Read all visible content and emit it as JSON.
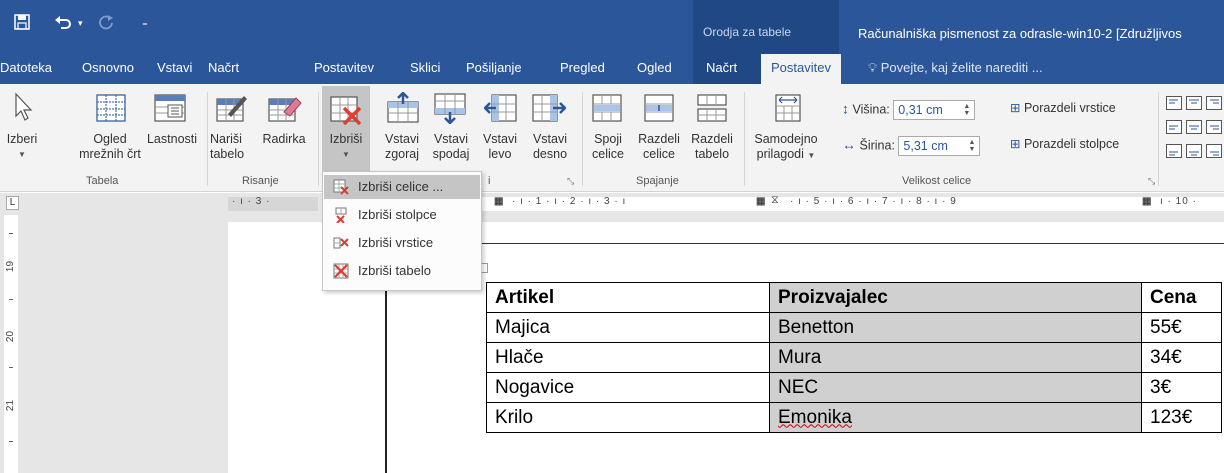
{
  "titlebar": {
    "contextual_group": "Orodja za tabele",
    "doc_title": "Računalniška pismenost za odrasle-win10-2 [Združljivos"
  },
  "tabs": [
    {
      "label": "Datoteka"
    },
    {
      "label": "Osnovno"
    },
    {
      "label": "Vstavi"
    },
    {
      "label": "Načrt"
    },
    {
      "label": "Postavitev"
    },
    {
      "label": "Sklici"
    },
    {
      "label": "Pošiljanje"
    },
    {
      "label": "Pregled"
    },
    {
      "label": "Ogled"
    },
    {
      "label": "Načrt"
    },
    {
      "label": "Postavitev"
    }
  ],
  "tell_me": "Povejte, kaj želite narediti ...",
  "ribbon": {
    "izberi": "Izberi",
    "ogled_1": "Ogled",
    "ogled_2": "mrežnih črt",
    "lastnosti": "Lastnosti",
    "narisi_1": "Nariši",
    "narisi_2": "tabelo",
    "radirka": "Radirka",
    "izbrisi": "Izbriši",
    "vstavi_zgoraj_1": "Vstavi",
    "vstavi_zgoraj_2": "zgoraj",
    "vstavi_spodaj_1": "Vstavi",
    "vstavi_spodaj_2": "spodaj",
    "vstavi_levo_1": "Vstavi",
    "vstavi_levo_2": "levo",
    "vstavi_desno_1": "Vstavi",
    "vstavi_desno_2": "desno",
    "spoji_1": "Spoji",
    "spoji_2": "celice",
    "razdeli_celice_1": "Razdeli",
    "razdeli_celice_2": "celice",
    "razdeli_tabelo_1": "Razdeli",
    "razdeli_tabelo_2": "tabelo",
    "samodejno_1": "Samodejno",
    "samodejno_2": "prilagodi",
    "visina_label": "Višina:",
    "visina_value": "0,31 cm",
    "sirina_label": "Širina:",
    "sirina_value": "5,31 cm",
    "porazdeli_vrstice": "Porazdeli vrstice",
    "porazdeli_stolpce": "Porazdeli stolpce",
    "groups": {
      "tabela": "Tabela",
      "risanje": "Risanje",
      "vrstice_fragment": "i",
      "spajanje": "Spajanje",
      "velikost": "Velikost celice"
    }
  },
  "ruler": {
    "left_text": "· ı · 3 ·",
    "right_text": "· ı · 1 · ı · 2 · ı · 3 · ı",
    "right_text_2": "· ı · 5 · ı · 6 · ı · 7 · ı · 8 · ı · 9",
    "right_text_3": "ı · 10 ·"
  },
  "vruler": [
    "19",
    "20",
    "21"
  ],
  "menu": [
    {
      "label": "Izbriši celice ...",
      "highlighted": true
    },
    {
      "label": "Izbriši stolpce",
      "highlighted": false
    },
    {
      "label": "Izbriši vrstice",
      "highlighted": false
    },
    {
      "label": "Izbriši tabelo",
      "highlighted": false
    }
  ],
  "table": {
    "headers": [
      "Artikel",
      "Proizvajalec",
      "Cena"
    ],
    "rows": [
      [
        "Majica",
        "Benetton",
        "55€"
      ],
      [
        "Hlače",
        "Mura",
        "34€"
      ],
      [
        "Nogavice",
        "NEC",
        "3€"
      ],
      [
        "Krilo",
        "Emonika",
        "123€"
      ]
    ]
  },
  "colors": {
    "brand": "#2b579a",
    "contextual": "#1f4885",
    "highlight": "#c5c5c5",
    "delete_red": "#e03c31"
  }
}
